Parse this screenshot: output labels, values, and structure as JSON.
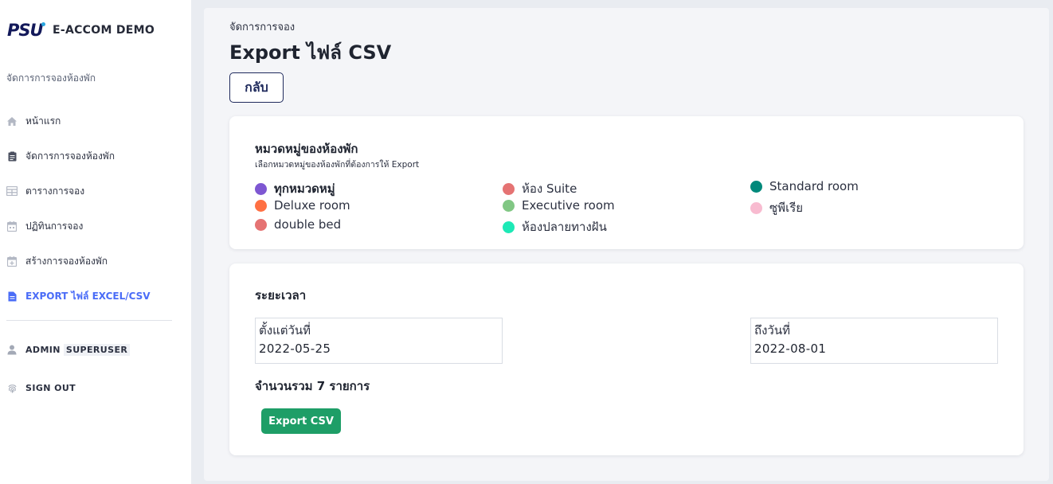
{
  "app": {
    "logo_text": "PSU",
    "name": "E-ACCOM DEMO"
  },
  "sidebar": {
    "section_title": "จัดการการจองห้องพัก",
    "items": [
      {
        "label": "หน้าแรก",
        "icon": "home-icon"
      },
      {
        "label": "จัดการการจองห้องพัก",
        "icon": "clipboard-icon"
      },
      {
        "label": "ตารางการจอง",
        "icon": "table-icon"
      },
      {
        "label": "ปฏิทินการจอง",
        "icon": "calendar-icon"
      },
      {
        "label": "สร้างการจองห้องพัก",
        "icon": "calendar-add-icon"
      },
      {
        "label": "EXPORT ไฟล์ EXCEL/CSV",
        "icon": "file-icon"
      }
    ],
    "active_index": 5,
    "user": {
      "name": "ADMIN",
      "role": "SUPERUSER"
    },
    "signout_label": "SIGN OUT"
  },
  "main": {
    "breadcrumb": "จัดการการจอง",
    "title": "Export ไฟล์ CSV",
    "back_label": "กลับ",
    "categories_card": {
      "title": "หมวดหมู่ของห้องพัก",
      "subtitle": "เลือกหมวดหมู่ของห้องพักที่ต้องการให้ Export",
      "items": [
        {
          "label": "ทุกหมวดหมู่",
          "color": "#7e57d2",
          "selected": true
        },
        {
          "label": "ห้อง Suite",
          "color": "#e57373",
          "selected": false
        },
        {
          "label": "Standard room",
          "color": "#00897b",
          "selected": false
        },
        {
          "label": "Deluxe room",
          "color": "#ff7043",
          "selected": false
        },
        {
          "label": "Executive room",
          "color": "#81c784",
          "selected": false
        },
        {
          "label": "ซูพีเรีย",
          "color": "#f8bbd0",
          "selected": false
        },
        {
          "label": "double bed",
          "color": "#e57373",
          "selected": false
        },
        {
          "label": "ห้องปลายทางฝัน",
          "color": "#1de9b6",
          "selected": false
        }
      ]
    },
    "period_card": {
      "title": "ระยะเวลา",
      "start_label": "ตั้งแต่วันที่",
      "start_value": "2022-05-25",
      "end_label": "ถึงวันที่",
      "end_value": "2022-08-01",
      "total_text": "จำนวนรวม 7 รายการ",
      "export_label": "Export CSV"
    }
  },
  "colors": {
    "accent": "#4a6cf7",
    "export_button": "#1e9e67",
    "back_button_border": "#1f2a5c"
  }
}
